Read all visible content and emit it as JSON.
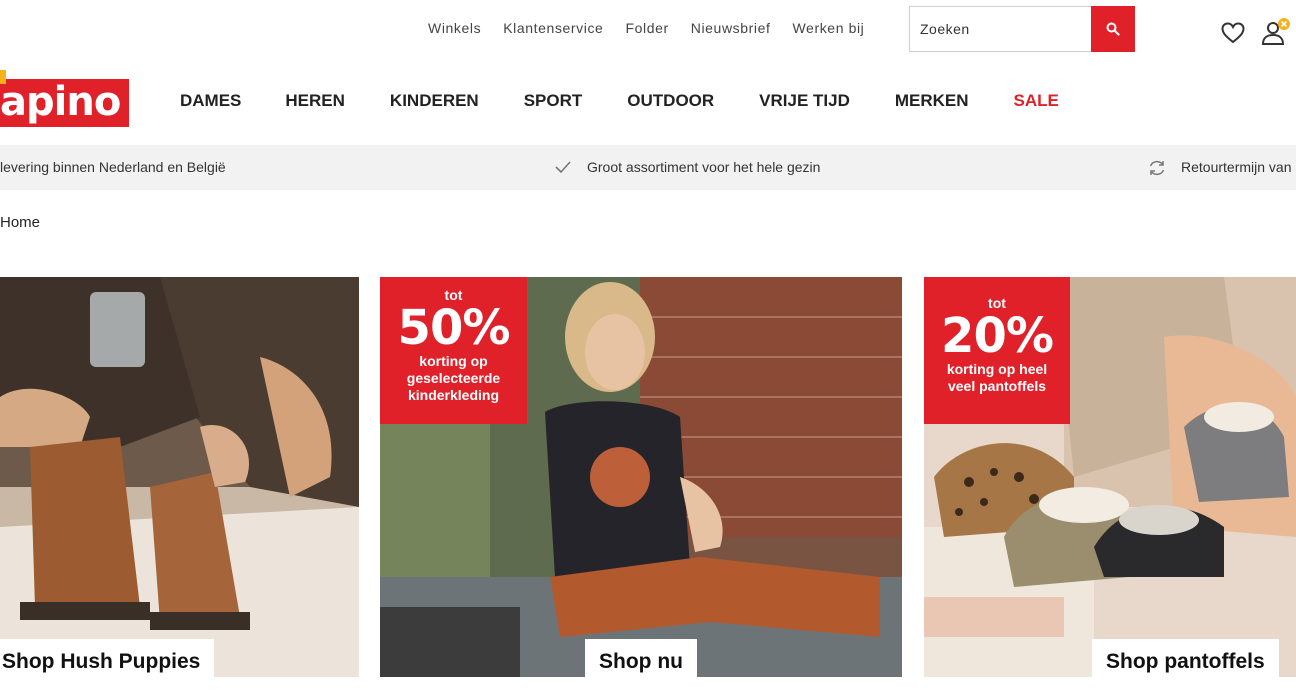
{
  "header": {
    "top_links": [
      "Winkels",
      "Klantenservice",
      "Folder",
      "Nieuwsbrief",
      "Werken bij"
    ],
    "search": {
      "placeholder": "Zoeken"
    },
    "logo_text": "apino"
  },
  "nav": {
    "items": [
      "DAMES",
      "HEREN",
      "KINDEREN",
      "SPORT",
      "OUTDOOR",
      "VRIJE TIJD",
      "MERKEN",
      "SALE"
    ]
  },
  "usp": {
    "items": [
      "levering binnen Nederland en België",
      "Groot assortiment voor het hele gezin",
      "Retourtermijn van"
    ]
  },
  "breadcrumb": {
    "home": "Home"
  },
  "banners": [
    {
      "cta": "Shop Hush Puppies"
    },
    {
      "badge_tot": "tot",
      "badge_pct": "50%",
      "badge_line1": "korting op",
      "badge_line2": "geselecteerde",
      "badge_line3": "kinderkleding",
      "cta": "Shop nu"
    },
    {
      "badge_tot": "tot",
      "badge_pct": "20%",
      "badge_line1": "korting op heel",
      "badge_line2": "veel pantoffels",
      "cta": "Shop pantoffels"
    }
  ],
  "colors": {
    "brand_red": "#e0212a",
    "accent_yellow": "#f6b11c",
    "usp_bg": "#f2f2f2"
  },
  "icons": [
    "search-icon",
    "heart-icon",
    "user-icon",
    "check-icon",
    "refresh-icon"
  ]
}
